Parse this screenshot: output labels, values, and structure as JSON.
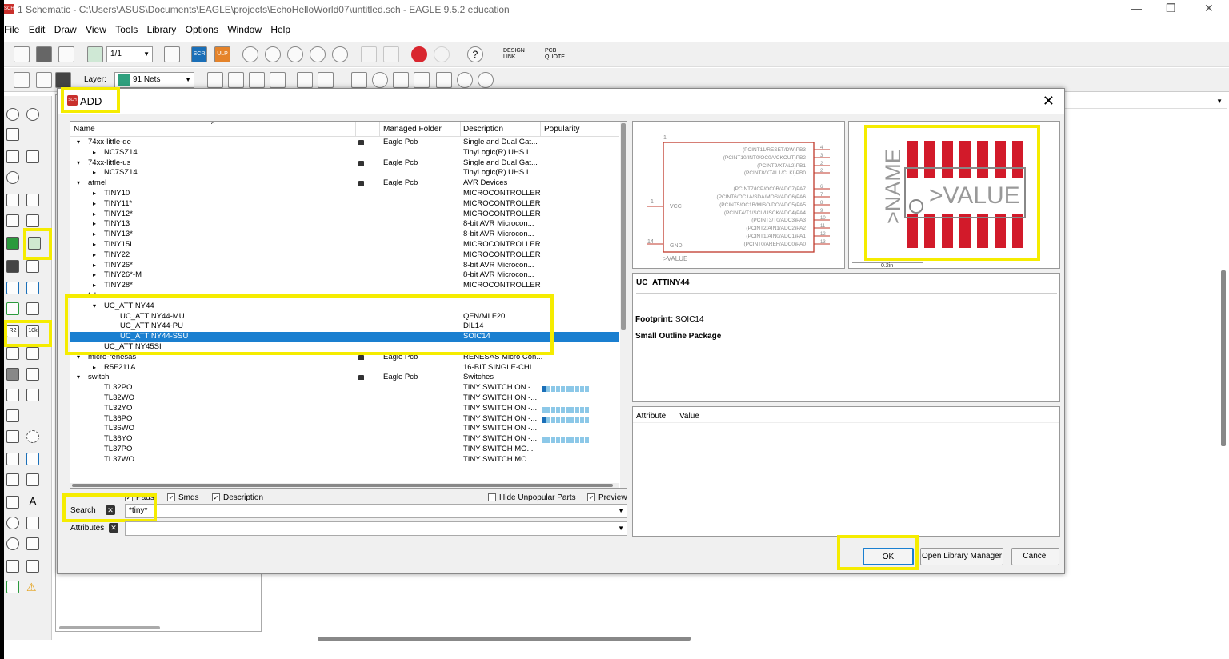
{
  "window": {
    "title": "1 Schematic - C:\\Users\\ASUS\\Documents\\EAGLE\\projects\\EchoHelloWorld07\\untitled.sch - EAGLE 9.5.2 education",
    "app_icon": "SCH"
  },
  "menu": [
    "File",
    "Edit",
    "Draw",
    "View",
    "Tools",
    "Library",
    "Options",
    "Window",
    "Help"
  ],
  "toolbar": {
    "sheet_value": "1/1",
    "layer_label": "Layer:",
    "layer_value": "91 Nets",
    "layer_color": "#2fa07e",
    "scr_label": "SCR",
    "ulp_label": "ULP",
    "design_link": "DESIGN LINK",
    "pcb_quote": "PCB QUOTE"
  },
  "dialog": {
    "title": "ADD",
    "icon": "SCH",
    "columns": [
      "Name",
      "Managed Folder",
      "Description",
      "Popularity"
    ],
    "rows": [
      {
        "indent": 0,
        "arrow": "▾",
        "name": "74xx-little-de",
        "lock": true,
        "folder": "Eagle Pcb",
        "desc": "Single and Dual Gat...",
        "pop": 0
      },
      {
        "indent": 1,
        "arrow": "▸",
        "name": "NC7SZ14",
        "lock": false,
        "folder": "",
        "desc": "TinyLogic(R) UHS I...",
        "pop": 0
      },
      {
        "indent": 0,
        "arrow": "▾",
        "name": "74xx-little-us",
        "lock": true,
        "folder": "Eagle Pcb",
        "desc": "Single and Dual Gat...",
        "pop": 0
      },
      {
        "indent": 1,
        "arrow": "▸",
        "name": "NC7SZ14",
        "lock": false,
        "folder": "",
        "desc": "TinyLogic(R) UHS I...",
        "pop": 0
      },
      {
        "indent": 0,
        "arrow": "▾",
        "name": "atmel",
        "lock": true,
        "folder": "Eagle Pcb",
        "desc": "AVR Devices",
        "pop": 0
      },
      {
        "indent": 1,
        "arrow": "▸",
        "name": "TINY10",
        "lock": false,
        "folder": "",
        "desc": "MICROCONTROLLER",
        "pop": 0
      },
      {
        "indent": 1,
        "arrow": "▸",
        "name": "TINY11*",
        "lock": false,
        "folder": "",
        "desc": "MICROCONTROLLER",
        "pop": 0
      },
      {
        "indent": 1,
        "arrow": "▸",
        "name": "TINY12*",
        "lock": false,
        "folder": "",
        "desc": "MICROCONTROLLER",
        "pop": 0
      },
      {
        "indent": 1,
        "arrow": "▸",
        "name": "TINY13",
        "lock": false,
        "folder": "",
        "desc": "8-bit AVR Microcon...",
        "pop": 0
      },
      {
        "indent": 1,
        "arrow": "▸",
        "name": "TINY13*",
        "lock": false,
        "folder": "",
        "desc": "8-bit AVR Microcon...",
        "pop": 0
      },
      {
        "indent": 1,
        "arrow": "▸",
        "name": "TINY15L",
        "lock": false,
        "folder": "",
        "desc": "MICROCONTROLLER",
        "pop": 0
      },
      {
        "indent": 1,
        "arrow": "▸",
        "name": "TINY22",
        "lock": false,
        "folder": "",
        "desc": "MICROCONTROLLER",
        "pop": 0
      },
      {
        "indent": 1,
        "arrow": "▸",
        "name": "TINY26*",
        "lock": false,
        "folder": "",
        "desc": "8-bit AVR Microcon...",
        "pop": 0
      },
      {
        "indent": 1,
        "arrow": "▸",
        "name": "TINY26*-M",
        "lock": false,
        "folder": "",
        "desc": "8-bit AVR Microcon...",
        "pop": 0
      },
      {
        "indent": 1,
        "arrow": "▸",
        "name": "TINY28*",
        "lock": false,
        "folder": "",
        "desc": "MICROCONTROLLER",
        "pop": 0
      },
      {
        "indent": 0,
        "arrow": "▾",
        "name": "fab",
        "lock": false,
        "folder": "",
        "desc": "",
        "pop": 0
      },
      {
        "indent": 1,
        "arrow": "▾",
        "name": "UC_ATTINY44",
        "lock": false,
        "folder": "",
        "desc": "",
        "pop": 0
      },
      {
        "indent": 2,
        "arrow": "",
        "name": "UC_ATTINY44-MU",
        "lock": false,
        "folder": "",
        "desc": "QFN/MLF20",
        "pop": 0
      },
      {
        "indent": 2,
        "arrow": "",
        "name": "UC_ATTINY44-PU",
        "lock": false,
        "folder": "",
        "desc": "DIL14",
        "pop": 0
      },
      {
        "indent": 2,
        "arrow": "",
        "name": "UC_ATTINY44-SSU",
        "lock": false,
        "folder": "",
        "desc": "SOIC14",
        "pop": 0,
        "selected": true
      },
      {
        "indent": 1,
        "arrow": "",
        "name": "UC_ATTINY45SI",
        "lock": false,
        "folder": "",
        "desc": "",
        "pop": 0
      },
      {
        "indent": 0,
        "arrow": "▾",
        "name": "micro-renesas",
        "lock": true,
        "folder": "Eagle Pcb",
        "desc": "RENESAS Micro Con...",
        "pop": 0
      },
      {
        "indent": 1,
        "arrow": "▸",
        "name": "R5F211A",
        "lock": false,
        "folder": "",
        "desc": "16-BIT SINGLE-CHI...",
        "pop": 0
      },
      {
        "indent": 0,
        "arrow": "▾",
        "name": "switch",
        "lock": true,
        "folder": "Eagle Pcb",
        "desc": "Switches",
        "pop": 0
      },
      {
        "indent": 1,
        "arrow": "",
        "name": "TL32PO",
        "lock": false,
        "folder": "",
        "desc": "TINY SWITCH ON -...",
        "pop": 2
      },
      {
        "indent": 1,
        "arrow": "",
        "name": "TL32WO",
        "lock": false,
        "folder": "",
        "desc": "TINY SWITCH ON -...",
        "pop": 0
      },
      {
        "indent": 1,
        "arrow": "",
        "name": "TL32YO",
        "lock": false,
        "folder": "",
        "desc": "TINY SWITCH ON -...",
        "pop": 1
      },
      {
        "indent": 1,
        "arrow": "",
        "name": "TL36PO",
        "lock": false,
        "folder": "",
        "desc": "TINY SWITCH ON -...",
        "pop": 2
      },
      {
        "indent": 1,
        "arrow": "",
        "name": "TL36WO",
        "lock": false,
        "folder": "",
        "desc": "TINY SWITCH ON -...",
        "pop": 0
      },
      {
        "indent": 1,
        "arrow": "",
        "name": "TL36YO",
        "lock": false,
        "folder": "",
        "desc": "TINY SWITCH ON -...",
        "pop": 1
      },
      {
        "indent": 1,
        "arrow": "",
        "name": "TL37PO",
        "lock": false,
        "folder": "",
        "desc": "TINY SWITCH MO...",
        "pop": 0
      },
      {
        "indent": 1,
        "arrow": "",
        "name": "TL37WO",
        "lock": false,
        "folder": "",
        "desc": "TINY SWITCH MO...",
        "pop": 0
      }
    ],
    "options": {
      "pads": "Pads",
      "smds": "Smds",
      "description": "Description",
      "hide_unpopular": "Hide Unpopular Parts",
      "preview": "Preview"
    },
    "search_label": "Search",
    "search_value": "*tiny*",
    "attributes_label": "Attributes",
    "attributes_value": "",
    "symbol": {
      "vcc": "VCC",
      "gnd": "GND",
      "value_label": ">VALUE",
      "pin1": "1",
      "pin14": "14",
      "pins": [
        {
          "num": "4",
          "label": "(PCINT11/RESET/DW)PB3"
        },
        {
          "num": "3",
          "label": "(PCINT10/INT0/OC0A/CKOUT)PB2"
        },
        {
          "num": "2",
          "label": "(PCINT9/XTAL2)PB1"
        },
        {
          "num": "2",
          "label": "(PCINT8/XTAL1/CLKI)PB0"
        },
        {
          "num": "6",
          "label": "(PCINT7/ICP/OC0B/ADC7)PA7"
        },
        {
          "num": "7",
          "label": "(PCINT6/OC1A/SDA/MOSI/ADC6)PA6"
        },
        {
          "num": "8",
          "label": "(PCINT5/OC1B/MISO/DO/ADC5)PA5"
        },
        {
          "num": "9",
          "label": "(PCINT4/T1/SCL/USCK/ADC4)PA4"
        },
        {
          "num": "10",
          "label": "(PCINT3/T0/ADC3)PA3"
        },
        {
          "num": "11",
          "label": "(PCINT2/AIN1/ADC2)PA2"
        },
        {
          "num": "12",
          "label": "(PCINT1/AIN0/ADC1)PA1"
        },
        {
          "num": "13",
          "label": "(PCINT0/AREF/ADC0)PA0"
        }
      ]
    },
    "footprint_preview": {
      "name_label": ">NAME",
      "value_label": ">VALUE",
      "scale": "0.2in",
      "pad_color": "#d21a2a"
    },
    "detail": {
      "device_name": "UC_ATTINY44",
      "footprint_label": "Footprint:",
      "footprint_value": "SOIC14",
      "package_desc": "Small Outline Package"
    },
    "attr_columns": [
      "Attribute",
      "Value"
    ],
    "buttons": {
      "ok": "OK",
      "library_manager": "Open Library Manager",
      "cancel": "Cancel"
    }
  },
  "highlight_color": "#f5ec00"
}
